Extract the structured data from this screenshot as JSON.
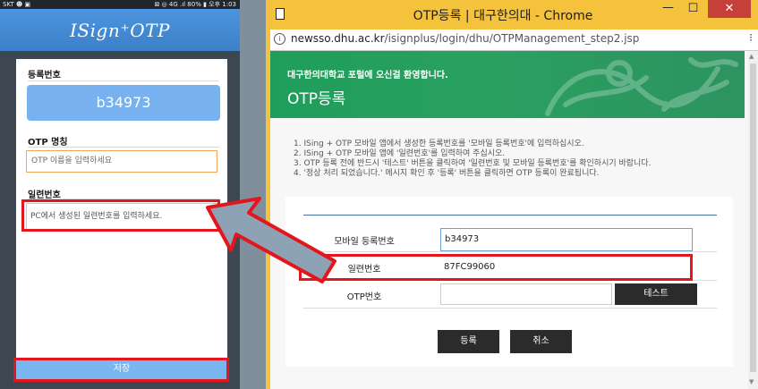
{
  "phone": {
    "status_left": "SKT ☻ ▣",
    "status_right": "⊠ ◎ 4G .ıl 80% ▮ 오후 1:03",
    "app_logo": "ISign⁺OTP",
    "registration_label": "등록번호",
    "registration_number": "b34973",
    "otp_name_label": "OTP 명칭",
    "otp_name_placeholder": "OTP 이름을 입력하세요",
    "serial_label": "일련번호",
    "serial_placeholder": "PC에서 생성된 일련번호를 입력하세요.",
    "save_label": "저장"
  },
  "chrome": {
    "window_title": "OTP등록 | 대구한의대 - Chrome",
    "minimize": "—",
    "maximize": "☐",
    "close": "✕",
    "url_host": "newsso.dhu.ac.kr",
    "url_path": "/isignplus/login/dhu/OTPManagement_step2.jsp",
    "info_icon": "i",
    "menu_icon": "⁝",
    "page": {
      "welcome": "대구한의대학교 포털에 오신걸 환영합니다.",
      "title": "OTP등록",
      "instructions": [
        "1. ISing + OTP 모바일 앱에서 생성한 등록번호를 '모바일 등록번호'에 입력하십시오.",
        "2. ISing + OTP 모바일 앱에 '일련번호'를 입력하여 주십시오.",
        "3. OTP 등록 전에 반드시 '테스트' 버튼을 클릭하여 '일련번호 및 모바일 등록번호'를 확인하시기 바랍니다.",
        "4. '정상 처리 되었습니다.' 메시지 확인 후 '등록' 버튼을 클릭하면 OTP 등록이 완료됩니다."
      ],
      "form": {
        "mobile_label": "모바일 등록번호",
        "mobile_value": "b34973",
        "serial_label": "일련번호",
        "serial_value": "87FC99060",
        "otp_label": "OTP번호",
        "otp_value": "",
        "test_label": "테스트",
        "register_label": "등록",
        "cancel_label": "취소"
      }
    }
  },
  "colors": {
    "highlight": "#e3151d",
    "arrow_fill": "#8ea2b6",
    "phone_accent": "#77b1ef",
    "banner_green": "#1f9e5b",
    "chrome_frame": "#f4c23b",
    "orange_focus": "#f0a55a"
  },
  "icons": {
    "page": "page-icon",
    "info": "info-icon",
    "menu": "kebab-menu-icon",
    "arrow": "annotation-arrow"
  }
}
